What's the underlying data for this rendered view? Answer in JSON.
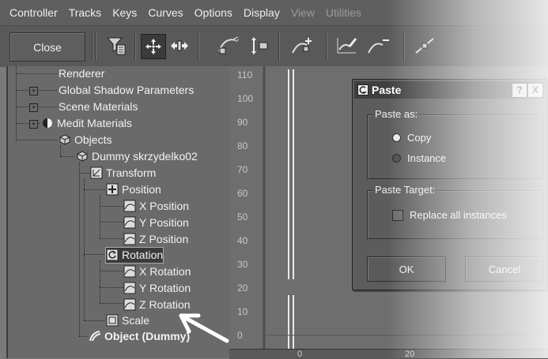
{
  "menubar": {
    "items": [
      "Controller",
      "Tracks",
      "Keys",
      "Curves",
      "Options",
      "Display",
      "View",
      "Utilities"
    ]
  },
  "toolbar": {
    "close_label": "Close",
    "icons": [
      "filter-icon",
      "move-keys-icon",
      "slide-keys-icon",
      "scale-keys-icon",
      "scale-values-icon",
      "add-keys-icon",
      "draw-curves-icon",
      "reduce-keys-icon",
      "tangent-icon"
    ]
  },
  "tree": {
    "items": [
      {
        "label": "Renderer"
      },
      {
        "label": "Global Shadow Parameters"
      },
      {
        "label": "Scene Materials"
      },
      {
        "label": "Medit Materials"
      },
      {
        "label": "Objects"
      },
      {
        "label": "Dummy skrzydelko02"
      },
      {
        "label": "Transform"
      },
      {
        "label": "Position"
      },
      {
        "label": "X Position"
      },
      {
        "label": "Y Position"
      },
      {
        "label": "Z Position"
      },
      {
        "label": "Rotation"
      },
      {
        "label": "X Rotation"
      },
      {
        "label": "Y Rotation"
      },
      {
        "label": "Z Rotation"
      },
      {
        "label": "Scale"
      },
      {
        "label": "Object (Dummy)"
      }
    ]
  },
  "curve_editor": {
    "y_ticks": [
      "110",
      "100",
      "90",
      "80",
      "70",
      "60",
      "50",
      "40",
      "30",
      "20",
      "10",
      "0"
    ],
    "x_ticks": [
      "0",
      "20"
    ]
  },
  "dialog": {
    "title": "Paste",
    "help_label": "?",
    "close_label": "X",
    "paste_as": {
      "label": "Paste as:",
      "options": [
        {
          "label": "Copy",
          "selected": true
        },
        {
          "label": "Instance",
          "selected": false
        }
      ]
    },
    "paste_target": {
      "label": "Paste Target:",
      "replace_label": "Replace all instances",
      "replace_checked": false
    },
    "ok_label": "OK",
    "cancel_label": "Cancel"
  }
}
